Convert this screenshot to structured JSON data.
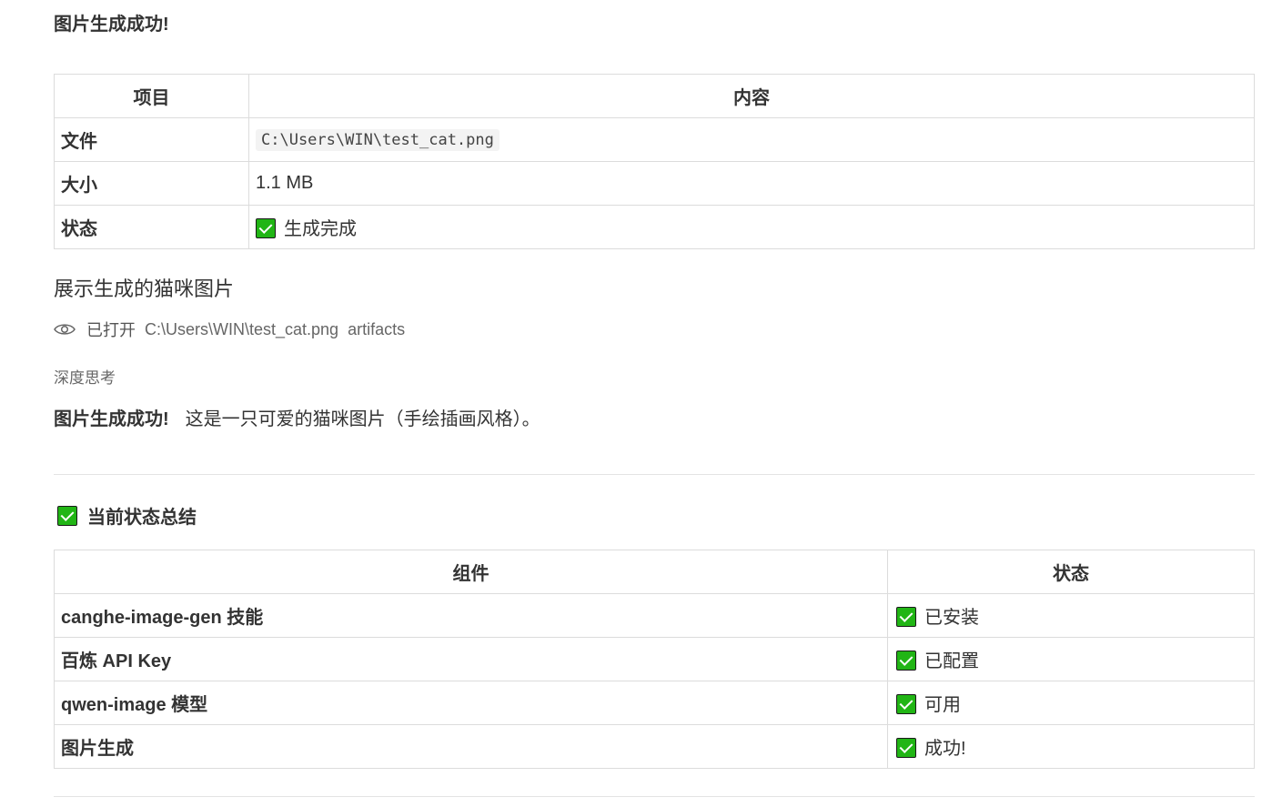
{
  "heading": "图片生成成功!",
  "file_table": {
    "headers": [
      "项目",
      "内容"
    ],
    "rows": [
      {
        "key": "文件",
        "value": "C:\\Users\\WIN\\test_cat.png"
      },
      {
        "key": "大小",
        "value": "1.1 MB"
      },
      {
        "key": "状态",
        "value": "生成完成"
      }
    ]
  },
  "section_title": "展示生成的猫咪图片",
  "opened": {
    "label": "已打开",
    "path": "C:\\Users\\WIN\\test_cat.png",
    "artifacts": "artifacts"
  },
  "deep_thinking": "深度思考",
  "result": {
    "bold": "图片生成成功!",
    "text": "这是一只可爱的猫咪图片（手绘插画风格）。"
  },
  "summary": {
    "title": "当前状态总结",
    "headers": [
      "组件",
      "状态"
    ],
    "rows": [
      {
        "component": "canghe-image-gen 技能",
        "status": "已安装"
      },
      {
        "component": "百炼 API Key",
        "status": "已配置"
      },
      {
        "component": "qwen-image 模型",
        "status": "可用"
      },
      {
        "component": "图片生成",
        "status": "成功!"
      }
    ]
  },
  "colors": {
    "check_green": "#21b515"
  },
  "icons": {
    "status_check": "check-box-icon",
    "opened": "eye-icon"
  }
}
